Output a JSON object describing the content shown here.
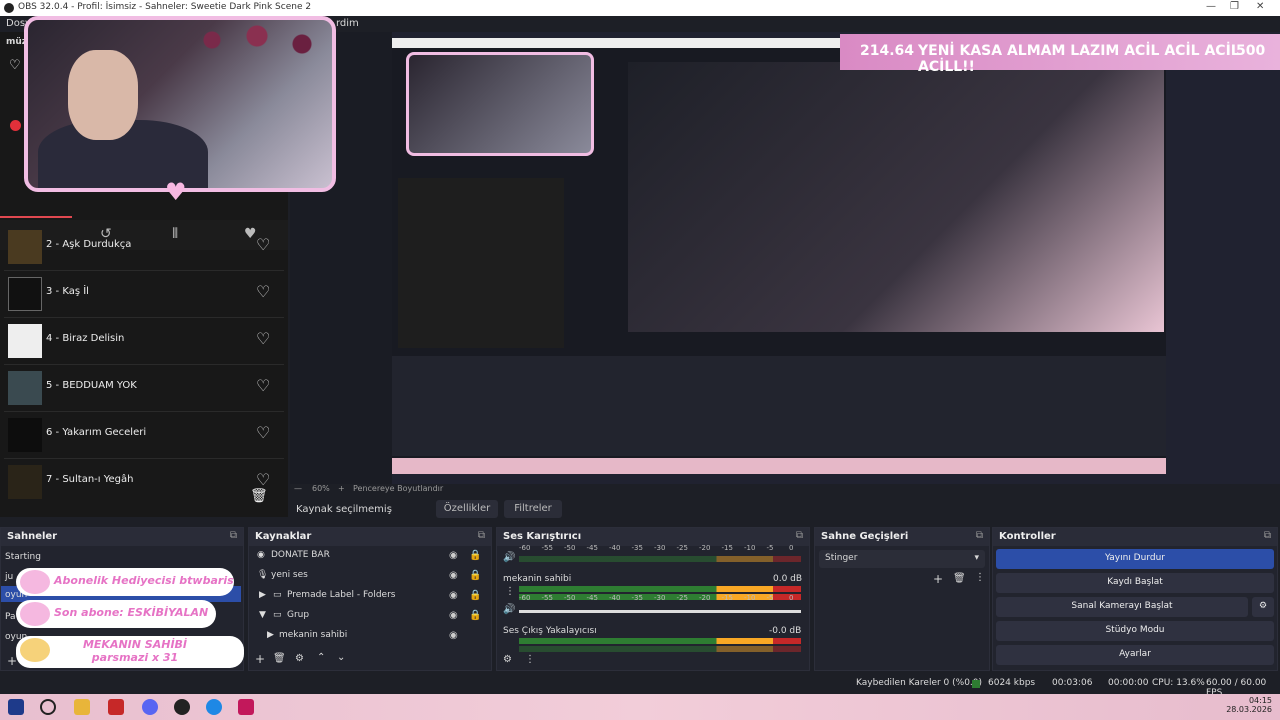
{
  "titlebar": {
    "title": "OBS 32.0.4 - Profil: İsimsiz - Sahneler: Sweetie Dark Pink Scene 2",
    "min": "—",
    "max": "❐",
    "close": "✕"
  },
  "menubar": {
    "first": "Dosy",
    "last": "rdim",
    "panel": "müz"
  },
  "overlay": {
    "amount": "214.64",
    "message": "YENİ KASA ALMAM LAZIM ACİL ACİL ACİL ACİLL!!",
    "goal": "500"
  },
  "music": {
    "tracks": [
      {
        "name": "2 - Aşk Durdukça"
      },
      {
        "name": "3 - Kaş İl"
      },
      {
        "name": "4 - Biraz Delisin"
      },
      {
        "name": "5 - BEDDUAM YOK"
      },
      {
        "name": "6 - Yakarım Geceleri"
      },
      {
        "name": "7 - Sultan-ı Yegâh"
      }
    ],
    "icons": {
      "heart": "♡",
      "queue": "≡",
      "history": "↺",
      "bars": "⦀",
      "heart_solid": "♥",
      "trash": "🗑"
    }
  },
  "toolbar": {
    "zoom": "60%",
    "minus": "—",
    "plus": "+",
    "resize": "Pencereye Boyutlandır"
  },
  "srcbar": {
    "status": "Kaynak seçilmemiş",
    "props": "Özellikler",
    "filters": "Filtreler"
  },
  "scenes": {
    "title": "Sahneler",
    "items": [
      "Starting",
      "ju",
      "oyun",
      "Pa",
      "oyun"
    ]
  },
  "alerts": [
    {
      "text": "Abonelik Hediyecisi btwbaris"
    },
    {
      "text": "Son abone: ESKİBİYALAN"
    },
    {
      "text": "MEKANIN SAHİBİ parsmazi x 31"
    }
  ],
  "sources": {
    "title": "Kaynaklar",
    "items": [
      {
        "name": "DONATE BAR"
      },
      {
        "name": "yeni ses"
      },
      {
        "name": "Premade Label - Folders"
      },
      {
        "name": "Grup"
      },
      {
        "name": "mekanin sahibi"
      }
    ]
  },
  "mixer": {
    "title": "Ses Karıştırıcı",
    "scale": [
      "-60",
      "-55",
      "-50",
      "-45",
      "-40",
      "-35",
      "-30",
      "-25",
      "-20",
      "-15",
      "-10",
      "-5",
      "0"
    ],
    "channels": [
      {
        "name": "mekanin sahibi",
        "db": "0.0 dB"
      },
      {
        "name": "Ses Çıkış Yakalayıcısı",
        "db": "-0.0 dB"
      }
    ]
  },
  "transitions": {
    "title": "Sahne Geçişleri",
    "selected": "Stinger"
  },
  "controls": {
    "title": "Kontroller",
    "buttons": [
      "Yayını Durdur",
      "Kaydı Başlat",
      "Sanal Kamerayı Başlat",
      "Stüdyo Modu",
      "Ayarlar"
    ]
  },
  "status": {
    "dropped": "Kaybedilen Kareler 0 (%0.0)",
    "bitrate": "6024 kbps",
    "stream_time": "00:03:06",
    "rec_time": "00:00:00",
    "cpu": "CPU: 13.6%",
    "fps": "60.00 / 60.00 FPS"
  },
  "clock": {
    "time": "04:15",
    "date": "28.03.2026"
  },
  "colors": {
    "accent": "#2c4ea8",
    "pink": "#f1bde3",
    "red": "#e04850"
  }
}
